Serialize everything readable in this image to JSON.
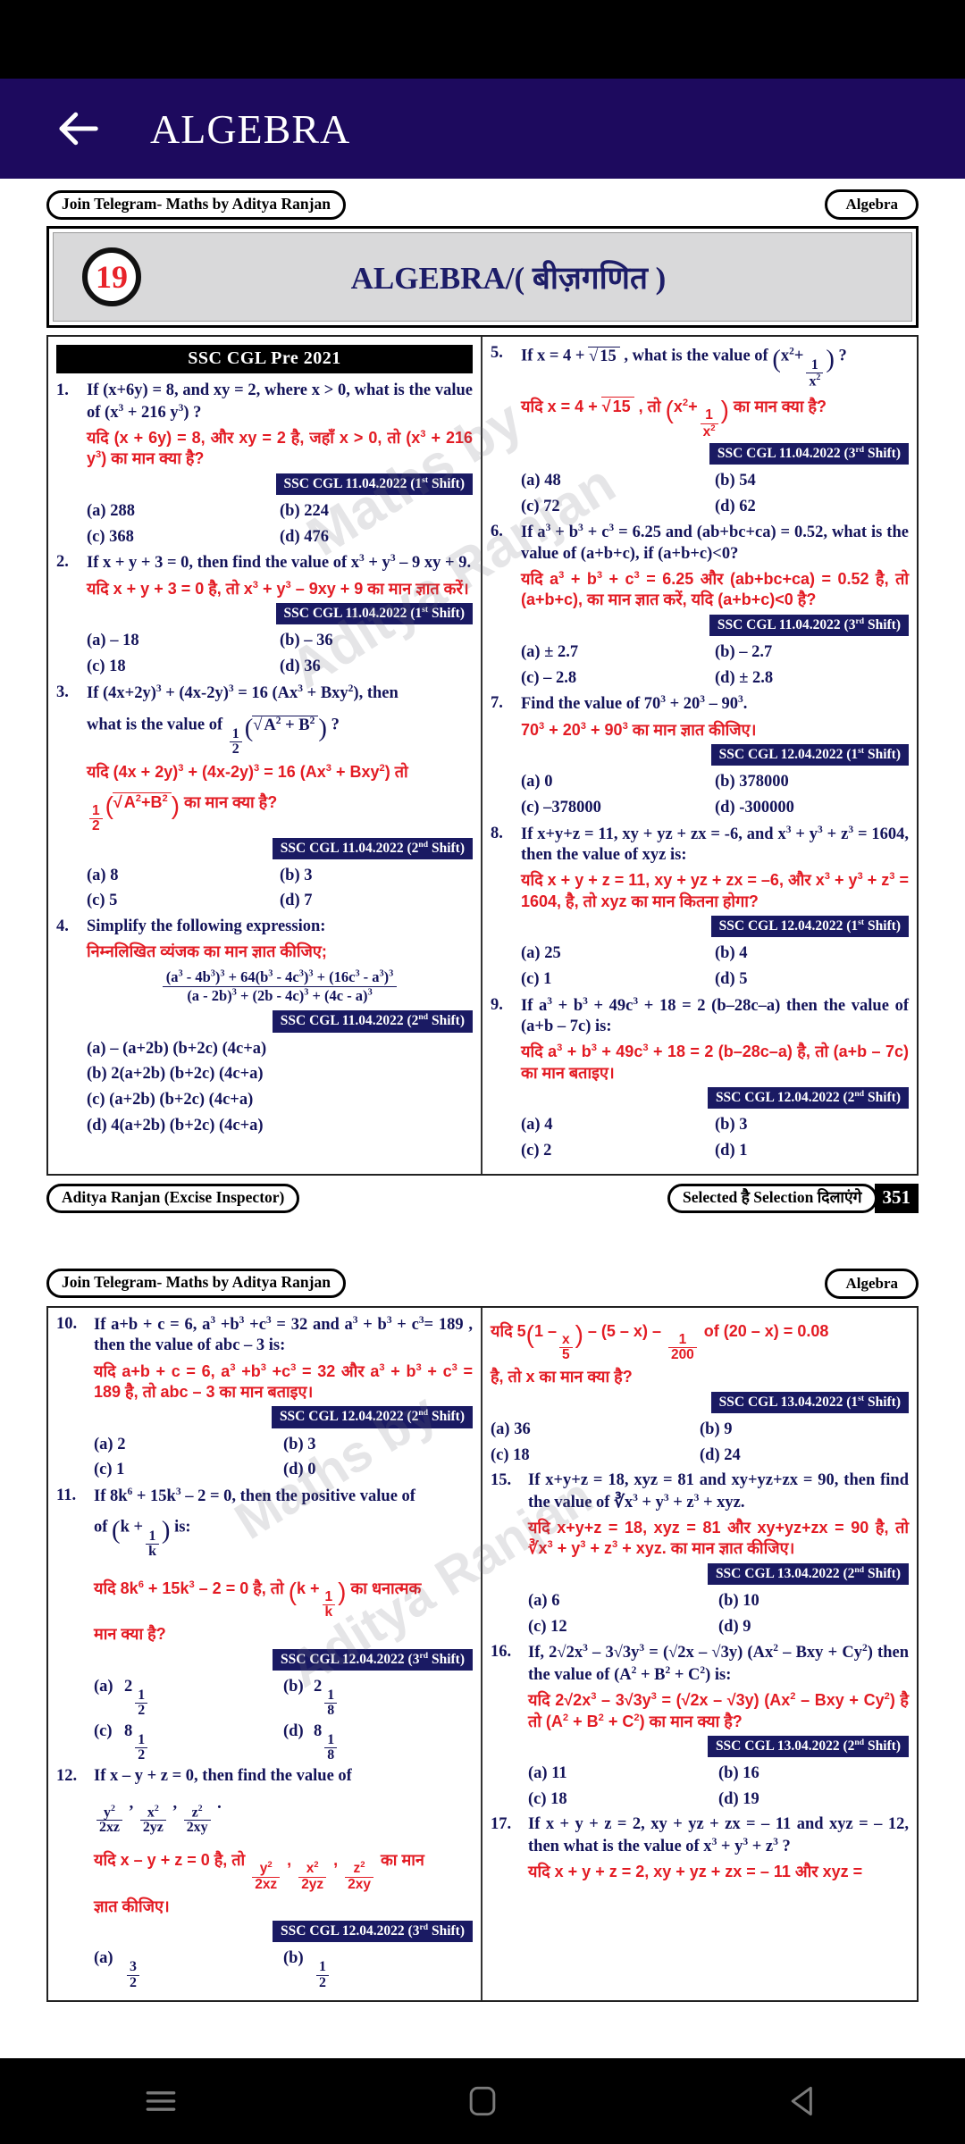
{
  "app": {
    "title": "ALGEBRA",
    "back_icon": "back-arrow-icon",
    "accent": "#1d0a5e"
  },
  "navbar": {
    "recents_icon": "recents-menu-icon",
    "home_icon": "home-square-icon",
    "back_icon": "back-triangle-icon"
  },
  "pages": [
    {
      "banner_left": "Join Telegram- Maths by  Aditya Ranjan",
      "banner_right": "Algebra",
      "chapter_number": "19",
      "chapter_title": "ALGEBRA/( बीज़गणित )",
      "exam_band": "SSC CGL Pre 2021",
      "footer_left": "Aditya Ranjan (Excise Inspector)",
      "footer_right": "Selected है Selection दिलाएंगे",
      "page_number": "351",
      "watermark": [
        "Maths by",
        "Aditya Ranjan"
      ],
      "left_column": [
        {
          "num": "1.",
          "en": "If (x+6y) = 8, and xy = 2, where x &gt; 0, what is the value of (x<sup>3</sup> + 216 y<sup>3</sup>) ?",
          "hi": "यदि (x + 6y) = 8, और xy = 2 है, जहाँ x &gt; 0, तो (x<sup>3</sup> + 216 y<sup>3</sup>) का मान क्या है?",
          "src": "SSC CGL 11.04.2022 (1<sup>st</sup> Shift)",
          "options": [
            "(a)  288",
            "(b)  224",
            "(c)  368",
            "(d)  476"
          ]
        },
        {
          "num": "2.",
          "en": "If x + y + 3 = 0, then find the value of x<sup>3</sup> + y<sup>3</sup> &ndash; 9 xy + 9.",
          "hi": "यदि x + y + 3 = 0 है, तो x<sup>3</sup> + y<sup>3</sup> &ndash; 9xy + 9 का मान ज्ञात करें।",
          "src": "SSC CGL 11.04.2022 (1<sup>st</sup> Shift)",
          "options": [
            "(a)  &ndash; 18",
            "(b)  &ndash; 36",
            "(c)  18",
            "(d)  36"
          ]
        },
        {
          "num": "3.",
          "en": "If (4x+2y)<sup>3</sup> + (4x-2y)<sup>3</sup> = 16 (Ax<sup>3</sup> + Bxy<sup>2</sup>), then",
          "en2_pre": "what is the value of ",
          "en2_post": " ?",
          "hi": "यदि (4x + 2y)<sup>3</sup> + (4x-2y)<sup>3</sup> = 16 (Ax<sup>3</sup> + Bxy<sup>2</sup>) तो",
          "hi2_post": " का मान क्या है?",
          "src": "SSC CGL 11.04.2022 (2<sup>nd</sup> Shift)",
          "options": [
            "(a)  8",
            "(b)  3",
            "(c)  5",
            "(d)  7"
          ]
        },
        {
          "num": "4.",
          "en": "Simplify the following expression:",
          "hi": "निम्नलिखित व्यंजक का मान ज्ञात कीजिए;",
          "expr_num": "(a<sup>3</sup> - 4b<sup>3</sup>)<sup>3</sup> + 64(b<sup>3</sup> - 4c<sup>3</sup>)<sup>3</sup> + (16c<sup>3</sup> - a<sup>3</sup>)<sup>3</sup>",
          "expr_den": "(a - 2b)<sup>3</sup> + (2b - 4c)<sup>3</sup> + (4c - a)<sup>3</sup>",
          "src": "SSC CGL 11.04.2022 (2<sup>nd</sup> Shift)",
          "options_full": [
            "(a) &ndash; (a+2b) (b+2c) (4c+a)",
            "(b) 2(a+2b) (b+2c) (4c+a)",
            "(c) (a+2b) (b+2c) (4c+a)",
            "(d) 4(a+2b) (b+2c) (4c+a)"
          ]
        }
      ],
      "right_column": [
        {
          "num": "5.",
          "en_pre": "If x = 4 + ",
          "en_rad": "15",
          "en_post": " , what is the value of ",
          "en_tail": " ?",
          "hi_pre": "यदि x = 4 + ",
          "hi_rad": "15",
          "hi_mid": " , तो ",
          "hi_tail": " का मान क्या है?",
          "src": "SSC CGL 11.04.2022 (3<sup>rd</sup> Shift)",
          "options": [
            "(a)  48",
            "(b)  54",
            "(c)  72",
            "(d)  62"
          ]
        },
        {
          "num": "6.",
          "en": "If a<sup>3</sup> + b<sup>3</sup> + c<sup>3</sup> = 6.25 and (ab+bc+ca) = 0.52, what is the value of (a+b+c), if (a+b+c)&lt;0?",
          "hi": "यदि a<sup>3</sup> + b<sup>3</sup> + c<sup>3</sup> = 6.25 और (ab+bc+ca) = 0.52 है, तो (a+b+c), का मान ज्ञात करें, यदि (a+b+c)&lt;0 है?",
          "src": "SSC CGL 11.04.2022 (3<sup>rd</sup> Shift)",
          "options": [
            "(a)  ± 2.7",
            "(b)  &ndash; 2.7",
            "(c)  &ndash; 2.8",
            "(d)  ± 2.8"
          ]
        },
        {
          "num": "7.",
          "en": "Find the value of 70<sup>3</sup> + 20<sup>3</sup> &ndash; 90<sup>3</sup>.",
          "hi": "70<sup>3</sup> + 20<sup>3</sup> + 90<sup>3</sup> का मान ज्ञात कीजिए।",
          "src": "SSC CGL 12.04.2022 (1<sup>st</sup> Shift)",
          "options": [
            "(a)  0",
            "(b)  378000",
            "(c)  &ndash;378000",
            "(d)  -300000"
          ]
        },
        {
          "num": "8.",
          "en": "If x+y+z =  11,  xy + yz + zx = -6, and x<sup>3</sup> + y<sup>3</sup> + z<sup>3</sup> = 1604, then the value of xyz is:",
          "hi": "यदि x + y + z = 11, xy + yz + zx = &ndash;6, और x<sup>3</sup> + y<sup>3</sup> + z<sup>3</sup> = 1604, है, तो xyz का मान कितना होगा?",
          "src": "SSC CGL 12.04.2022 (1<sup>st</sup> Shift)",
          "options": [
            "(a)  25",
            "(b)  4",
            "(c)  1",
            "(d)  5"
          ]
        },
        {
          "num": "9.",
          "en": "If a<sup>3</sup> + b<sup>3</sup> + 49c<sup>3</sup> + 18 = 2 (b&ndash;28c&ndash;a) then the value of (a+b &ndash; 7c) is:",
          "hi": "यदि a<sup>3</sup> + b<sup>3</sup> + 49c<sup>3</sup> + 18 = 2 (b&ndash;28c&ndash;a) है, तो (a+b &ndash; 7c) का मान बताइए।",
          "src": "SSC CGL 12.04.2022 (2<sup>nd</sup> Shift)",
          "options": [
            "(a)  4",
            "(b)  3",
            "(c)  2",
            "(d)  1"
          ]
        }
      ]
    },
    {
      "banner_left": "Join Telegram- Maths by  Aditya Ranjan",
      "banner_right": "Algebra",
      "watermark": [
        "Maths by",
        "Aditya Ranjan"
      ],
      "left_column": [
        {
          "num": "10.",
          "en": "If a+b + c = 6, a<sup>3</sup> +b<sup>3</sup> +c<sup>3</sup> = 32 and a<sup>3</sup> + b<sup>3</sup> + c<sup>3</sup>= 189 , then the value of abc &ndash; 3 is:",
          "hi": "यदि a+b + c = 6, a<sup>3</sup> +b<sup>3</sup> +c<sup>3</sup> = 32 और a<sup>3</sup> + b<sup>3</sup> + c<sup>3</sup> = 189 है, तो abc &ndash; 3 का मान बताइए।",
          "src": "SSC CGL 12.04.2022 (2<sup>nd</sup> Shift)",
          "options": [
            "(a)  2",
            "(b)  3",
            "(c)  1",
            "(d)  0"
          ]
        },
        {
          "num": "11.",
          "en_pre": "If 8k<sup>6</sup> + 15k<sup>3</sup> &ndash; 2 = 0, then the positive value of ",
          "en_post": " is:",
          "hi_post": " का धनात्मक मान क्या है?",
          "hi_pre": "यदि 8k<sup>6</sup> + 15k<sup>3</sup> &ndash; 2 = 0 है, तो ",
          "src": "SSC CGL 12.04.2022 (3<sup>rd</sup> Shift)",
          "options_frac": [
            {
              "lbl": "(a)",
              "whole": "2",
              "num": "1",
              "den": "2"
            },
            {
              "lbl": "(b)",
              "whole": "2",
              "num": "1",
              "den": "8"
            },
            {
              "lbl": "(c)",
              "whole": "8",
              "num": "1",
              "den": "2"
            },
            {
              "lbl": "(d)",
              "whole": "8",
              "num": "1",
              "den": "8"
            }
          ]
        },
        {
          "num": "12.",
          "en_pre": "If x &ndash; y + z = 0, then find the value of ",
          "hi_pre": "यदि x &ndash; y + z = 0 है, तो ",
          "hi_post": " का मान ज्ञात कीजिए।",
          "frac_terms": [
            {
              "num": "y<sup>2</sup>",
              "den": "2xz"
            },
            {
              "num": "x<sup>2</sup>",
              "den": "2yz"
            },
            {
              "num": "z<sup>2</sup>",
              "den": "2xy"
            }
          ],
          "src": "SSC CGL 12.04.2022 (3<sup>rd</sup> Shift)"
        }
      ],
      "right_column": [
        {
          "num": "",
          "hi_head_pre": "यदि 5",
          "hi_head_post": " of  (20 &ndash; x) = 0.08 है, तो x का मान क्या है?",
          "src": "SSC CGL 13.04.2022 (1<sup>st</sup> Shift)",
          "options": [
            "(a)  36",
            "(b)  9",
            "(c)  18",
            "(d)  24"
          ]
        },
        {
          "num": "15.",
          "en": "If x+y+z = 18, xyz = 81 and xy+yz+zx = 90, then find the value of ∛x<sup>3</sup> + y<sup>3</sup> + z<sup>3</sup> + xyz.",
          "hi": "यदि x+y+z = 18, xyz = 81 और xy+yz+zx = 90 है, तो ∛x<sup>3</sup> + y<sup>3</sup> + z<sup>3</sup> + xyz. का मान ज्ञात कीजिए।",
          "src": "SSC CGL 13.04.2022 (2<sup>nd</sup> Shift)",
          "options": [
            "(a)  6",
            "(b)  10",
            "(c)  12",
            "(d)  9"
          ]
        },
        {
          "num": "16.",
          "en": "If,  2√2x<sup>3</sup> &ndash; 3√3y<sup>3</sup> = (√2x &ndash; √3y) (Ax<sup>2</sup> &ndash;  Bxy + Cy<sup>2</sup>) then the value of (A<sup>2</sup> + B<sup>2</sup> + C<sup>2</sup>) is:",
          "hi": "यदि  2√2x<sup>3</sup> &ndash; 3√3y<sup>3</sup> = (√2x &ndash; √3y) (Ax<sup>2</sup> &ndash; Bxy + Cy<sup>2</sup>) है तो (A<sup>2</sup> + B<sup>2</sup> + C<sup>2</sup>) का मान क्या है?",
          "src": "SSC CGL 13.04.2022 (2<sup>nd</sup> Shift)",
          "options": [
            "(a)  11",
            "(b)  16",
            "(c)  18",
            "(d)  19"
          ]
        },
        {
          "num": "17.",
          "en": "If x + y + z = 2, xy + yz + zx = &ndash; 11 and xyz = &ndash; 12,   then   what   is   the   value   of x<sup>3</sup> + y<sup>3</sup> + z<sup>3</sup> ?",
          "hi": "यदि x + y + z = 2, xy + yz + zx = &ndash; 11 और xyz =",
          "src": "",
          "options": []
        }
      ]
    }
  ]
}
